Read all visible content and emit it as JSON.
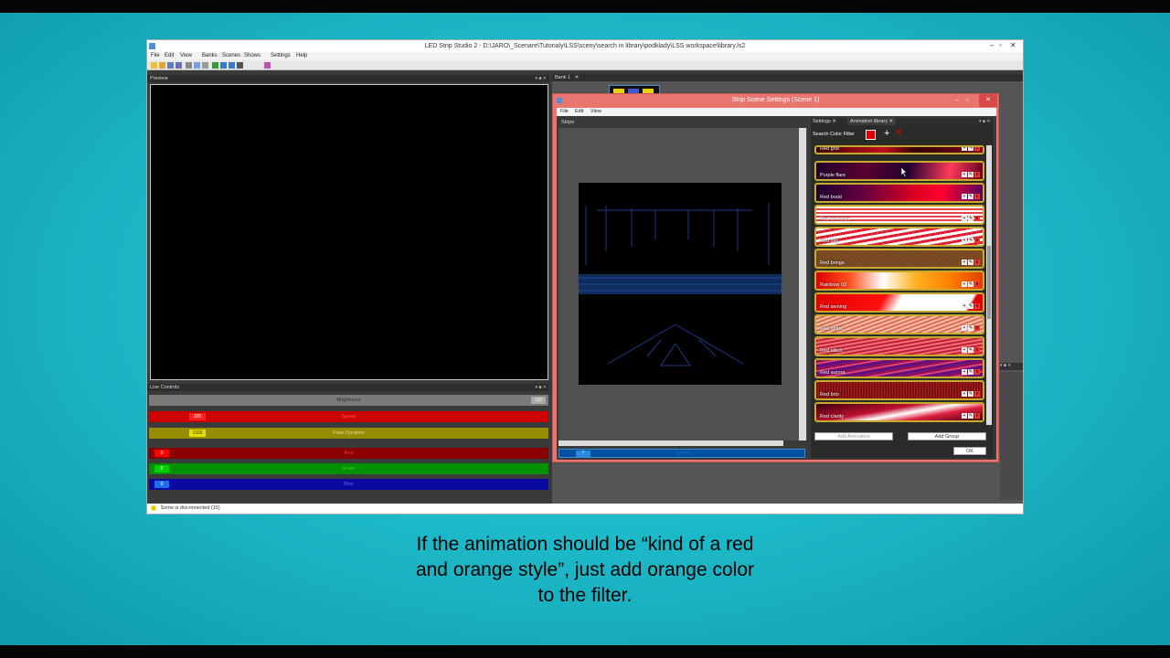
{
  "window": {
    "title": "LED Strip Studio 2 - D:\\JARO\\_Scenare\\Tutorialy\\LSS\\sceny\\search in library\\podklady\\LSS workspace\\library.ls2",
    "menu": [
      "File",
      "Edit",
      "View",
      "Banks",
      "Scenes",
      "Shows",
      "Settings",
      "Help"
    ]
  },
  "preview": {
    "title": "Preview"
  },
  "live_controls": {
    "title": "Live Controls",
    "rows": [
      {
        "label": "Brightness",
        "value": "100",
        "color": "#777777"
      },
      {
        "label": "Speed",
        "value": "100",
        "color": "#b00000"
      },
      {
        "label": "Fade Duration",
        "value": "1000",
        "color": "#8c8200"
      },
      {
        "label": "Red",
        "value": "0",
        "color": "#8a0000"
      },
      {
        "label": "Green",
        "value": "0",
        "color": "#008a00"
      },
      {
        "label": "Blue",
        "value": "0",
        "color": "#0a0aa0"
      }
    ]
  },
  "bank_tab": "Bank 1",
  "status": "Some is disconnected (15)",
  "dialog": {
    "title": "Strip Scene Settings (Scene 1)",
    "menu": [
      "File",
      "Edit",
      "View"
    ],
    "strips_tab": "Strips",
    "tabs": [
      "Settings",
      "Animation library"
    ],
    "search_label": "Search Color Filter",
    "speed_value": "7",
    "speed_label": "Speed",
    "animations": [
      {
        "name": "Red grid"
      },
      {
        "name": "Purple flare"
      },
      {
        "name": "Red braid"
      },
      {
        "name": "Red sin strips"
      },
      {
        "name": "Red zag"
      },
      {
        "name": "Red bringe"
      },
      {
        "name": "Rainbow 03"
      },
      {
        "name": "Red awning"
      },
      {
        "name": "Red stripe"
      },
      {
        "name": "Red stitch"
      },
      {
        "name": "Red aurora"
      },
      {
        "name": "Red brio"
      },
      {
        "name": "Red clarity"
      }
    ],
    "add_animation": "Add Animation",
    "add_group": "Add Group",
    "ok": "OK"
  },
  "caption": [
    "If the animation should be “kind of a red",
    "and orange style”, just add orange color",
    "to the filter."
  ]
}
